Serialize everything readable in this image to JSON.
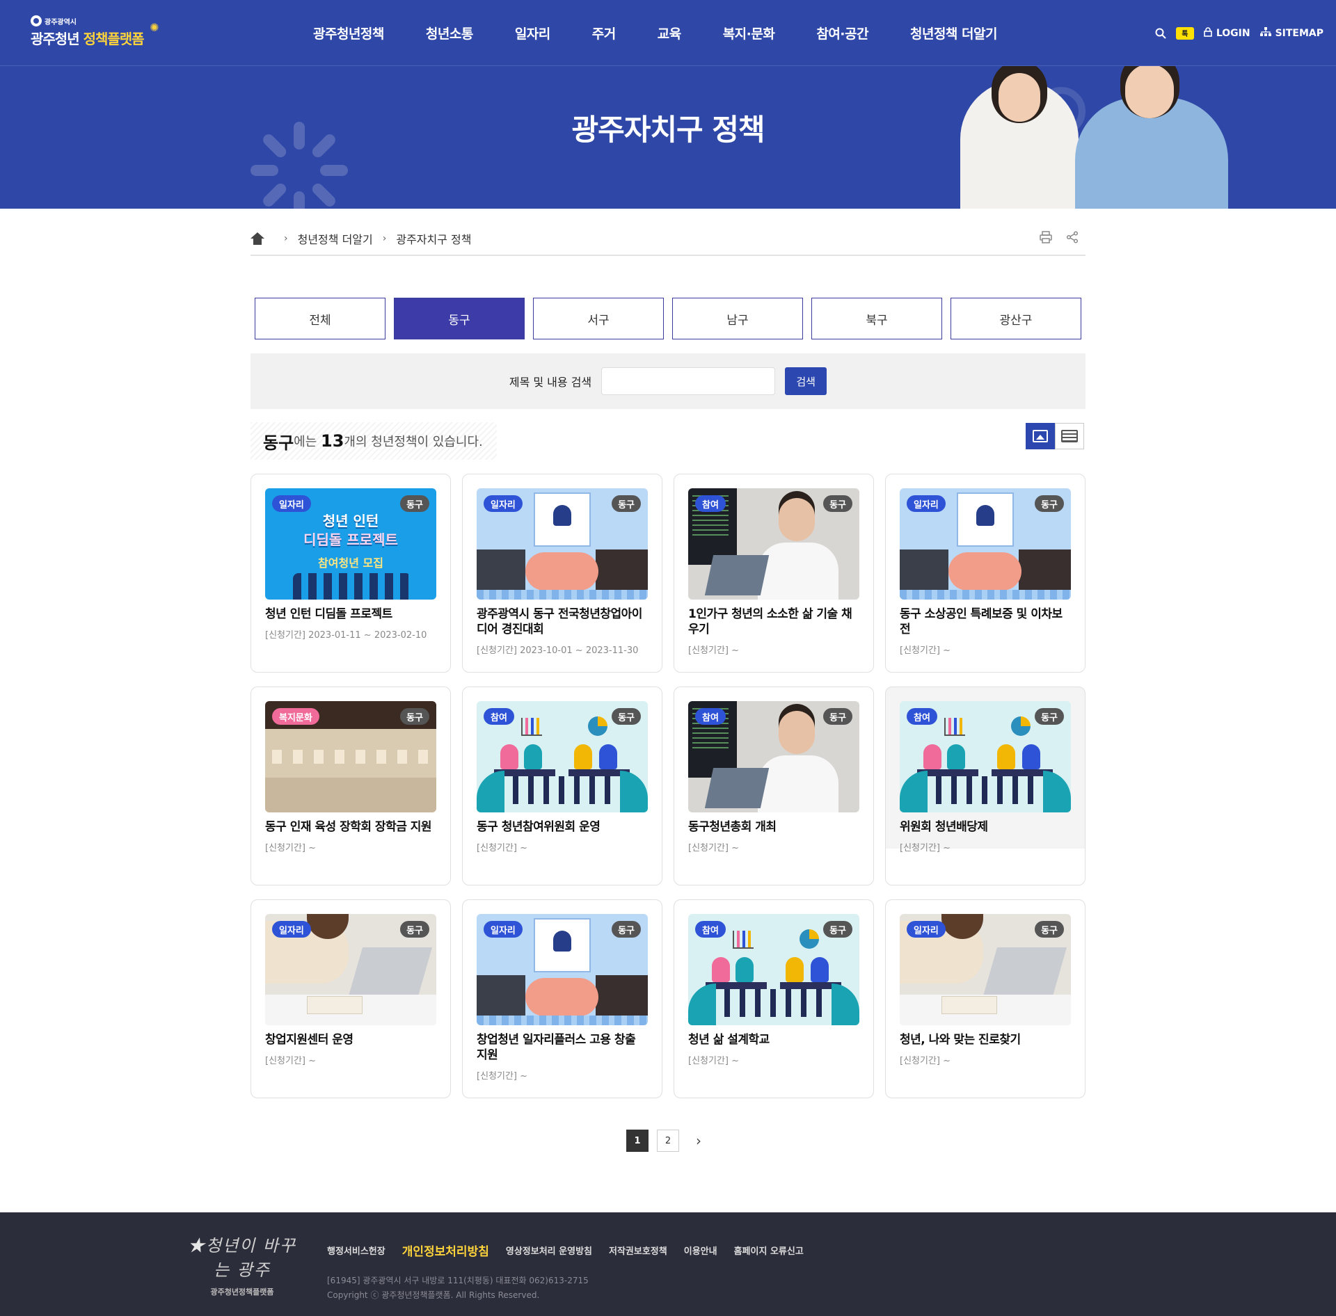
{
  "header": {
    "logo_small": "광주광역시",
    "logo_main": "광주청년",
    "logo_highlight": "정책플랫폼",
    "nav": [
      "광주청년정책",
      "청년소통",
      "일자리",
      "주거",
      "교육",
      "복지·문화",
      "참여·공간",
      "청년정책 더알기"
    ],
    "util": {
      "kakao": "톡",
      "login": "LOGIN",
      "sitemap": "SITEMAP"
    }
  },
  "banner": {
    "title": "광주자치구 정책"
  },
  "breadcrumb": {
    "level1": "청년정책 더알기",
    "level2": "광주자치구 정책"
  },
  "tabs": [
    {
      "label": "전체",
      "active": false
    },
    {
      "label": "동구",
      "active": true
    },
    {
      "label": "서구",
      "active": false
    },
    {
      "label": "남구",
      "active": false
    },
    {
      "label": "북구",
      "active": false
    },
    {
      "label": "광산구",
      "active": false
    }
  ],
  "search": {
    "label": "제목 및 내용 검색",
    "value": "",
    "button": "검색"
  },
  "summary": {
    "district": "동구",
    "part1": "에는 ",
    "count": "13",
    "part2": "개의 청년정책이 있습니다."
  },
  "cards": [
    {
      "category": "일자리",
      "district": "동구",
      "title": "청년 인턴 디딤돌 프로젝트",
      "period": "[신청기간] 2023-01-11 ~ 2023-02-10",
      "thumb": "intern",
      "thumb_text1": "청년 인턴",
      "thumb_text2": "디딤돌 프로젝트",
      "thumb_text3": "참여청년 모집"
    },
    {
      "category": "일자리",
      "district": "동구",
      "title": "광주광역시 동구 전국청년창업아이디어 경진대회",
      "period": "[신청기간] 2023-10-01 ~ 2023-11-30",
      "thumb": "hand"
    },
    {
      "category": "참여",
      "district": "동구",
      "title": "1인가구 청년의 소소한 삶 기술 채우기",
      "period": "[신청기간] ~",
      "thumb": "office"
    },
    {
      "category": "일자리",
      "district": "동구",
      "title": "동구 소상공인 특례보증 및 이차보전",
      "period": "[신청기간] ~",
      "thumb": "hand"
    },
    {
      "category": "복지문화",
      "district": "동구",
      "title": "동구 인재 육성 장학회 장학금 지원",
      "period": "[신청기간] ~",
      "thumb": "gallery"
    },
    {
      "category": "참여",
      "district": "동구",
      "title": "동구 청년참여위원회 운영",
      "period": "[신청기간] ~",
      "thumb": "meet"
    },
    {
      "category": "참여",
      "district": "동구",
      "title": "동구청년총회 개최",
      "period": "[신청기간] ~",
      "thumb": "office"
    },
    {
      "category": "참여",
      "district": "동구",
      "title": "위원회 청년배당제",
      "period": "[신청기간] ~",
      "thumb": "meet"
    },
    {
      "category": "일자리",
      "district": "동구",
      "title": "창업지원센터 운영",
      "period": "[신청기간] ~",
      "thumb": "desk"
    },
    {
      "category": "일자리",
      "district": "동구",
      "title": "창업청년 일자리플러스 고용 창출 지원",
      "period": "[신청기간] ~",
      "thumb": "hand"
    },
    {
      "category": "참여",
      "district": "동구",
      "title": "청년 삶 설계학교",
      "period": "[신청기간] ~",
      "thumb": "meet"
    },
    {
      "category": "일자리",
      "district": "동구",
      "title": "청년, 나와 맞는 진로찾기",
      "period": "[신청기간] ~",
      "thumb": "desk"
    }
  ],
  "pagination": {
    "pages": [
      "1",
      "2"
    ],
    "current": "1",
    "next": "›"
  },
  "footer": {
    "logo_script": "청년이 바꾸는 광주",
    "logo_name": "광주청년정책플랫폼",
    "links": [
      "행정서비스헌장",
      "개인정보처리방침",
      "영상정보처리 운영방침",
      "저작권보호정책",
      "이용안내",
      "홈페이지 오류신고"
    ],
    "highlight_link": "개인정보처리방침",
    "address": "[61945] 광주광역시 서구 내방로 111(치평동) 대표전화 062)613-2715",
    "copyright": "Copyright ⓒ 광주청년정책플랫폼. All Rights Reserved."
  },
  "colors": {
    "primary": "#2f48a7",
    "tab_active": "#3d3ba8",
    "button": "#2c48b0",
    "footer": "#2c2d3a",
    "accent_yellow": "#ffd43b"
  }
}
